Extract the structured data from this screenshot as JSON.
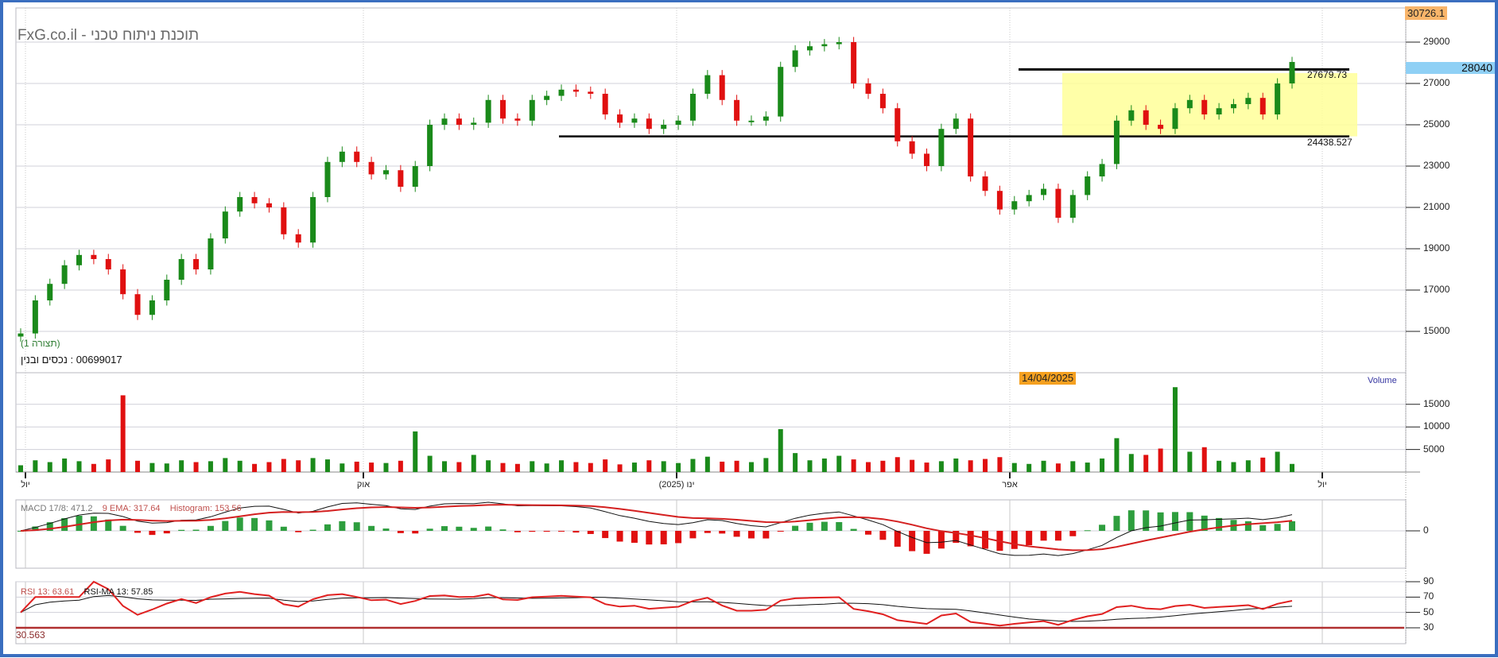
{
  "header": {
    "title": "FxG.co.il - תוכנת ניתוח טכני",
    "configuration": "(תצורה 1)",
    "symbol": "00699017 : נכסים ובנין"
  },
  "badges": {
    "high_value": "30726.1",
    "current_price": "28040",
    "crosshair_date": "14/04/2025"
  },
  "levels": {
    "resistance": "27679.73",
    "support": "24438.527"
  },
  "colors": {
    "up": "#1a8a1a",
    "down": "#e01010",
    "frame": "#3a6ebf",
    "zone": "#ffff99",
    "macd_signal": "#d42020",
    "rsi_line": "#e02020"
  },
  "legends": {
    "volume": "Volume",
    "macd": "MACD 17/8: 471.2",
    "macd_ema": "9 EMA: 317.64",
    "macd_hist": "Histogram: 153.56",
    "rsi": "RSI 13: 63.61",
    "rsi_ma": "RSI-MA 13: 57.85",
    "rsi_low": "30.563"
  },
  "chart_data": {
    "type": "candlestick",
    "x_labels": [
      "יול",
      "אוק",
      "ינו (2025)",
      "אפר",
      "יול"
    ],
    "price_axis": {
      "ticks": [
        "29000",
        "27000",
        "25000",
        "23000",
        "21000",
        "19000",
        "17000",
        "15000"
      ],
      "range": [
        14000,
        30726.1
      ]
    },
    "volume_axis": {
      "ticks": [
        "15000",
        "10000",
        "5000"
      ]
    },
    "macd_axis": {
      "ticks": [
        "0"
      ]
    },
    "rsi_axis": {
      "ticks": [
        "90",
        "70",
        "50",
        "30"
      ]
    },
    "zone": {
      "from": 24438.527,
      "to": 27679.73
    },
    "close": [
      14900,
      16500,
      17300,
      18200,
      18700,
      18500,
      18000,
      16800,
      15800,
      16500,
      17500,
      18500,
      18000,
      19500,
      20800,
      21500,
      21200,
      21000,
      19700,
      19300,
      21500,
      23200,
      23700,
      23200,
      22600,
      22800,
      22000,
      23000,
      25000,
      25300,
      25000,
      25100,
      26200,
      25300,
      25200,
      26200,
      26400,
      26700,
      26600,
      26500,
      25500,
      25100,
      25300,
      24800,
      25000,
      25200,
      26500,
      27400,
      26200,
      25200,
      25200,
      25400,
      27800,
      28600,
      28800,
      28900,
      29000,
      27000,
      26500,
      25800,
      24200,
      23600,
      23000,
      24800,
      25300,
      22500,
      21800,
      20900,
      21300,
      21600,
      21900,
      20500,
      21600,
      22500,
      23100,
      25200,
      25700,
      25000,
      24800,
      25800,
      26200,
      25500,
      25800,
      26000,
      26300,
      25500,
      27000,
      28040
    ],
    "volume": [
      1500,
      2600,
      2200,
      3000,
      2400,
      1800,
      2800,
      17000,
      2500,
      2000,
      1900,
      2600,
      2200,
      2400,
      3100,
      2500,
      1800,
      2200,
      2900,
      2600,
      3100,
      2800,
      1900,
      2300,
      2100,
      2000,
      2500,
      9000,
      3600,
      2400,
      2200,
      3800,
      2600,
      2000,
      1800,
      2400,
      1900,
      2600,
      2200,
      2000,
      2800,
      1700,
      2100,
      2600,
      2400,
      2000,
      2900,
      3400,
      2300,
      2500,
      2200,
      3100,
      9500,
      4200,
      2600,
      3000,
      3600,
      2800,
      2200,
      2500,
      3300,
      2700,
      2100,
      2400,
      3000,
      2600,
      2900,
      3300,
      2000,
      1800,
      2500,
      1900,
      2400,
      2100,
      3000,
      7500,
      4000,
      3800,
      5200,
      18800,
      4500,
      5500,
      2500,
      2200,
      2600,
      3200,
      4500,
      1800
    ]
  }
}
